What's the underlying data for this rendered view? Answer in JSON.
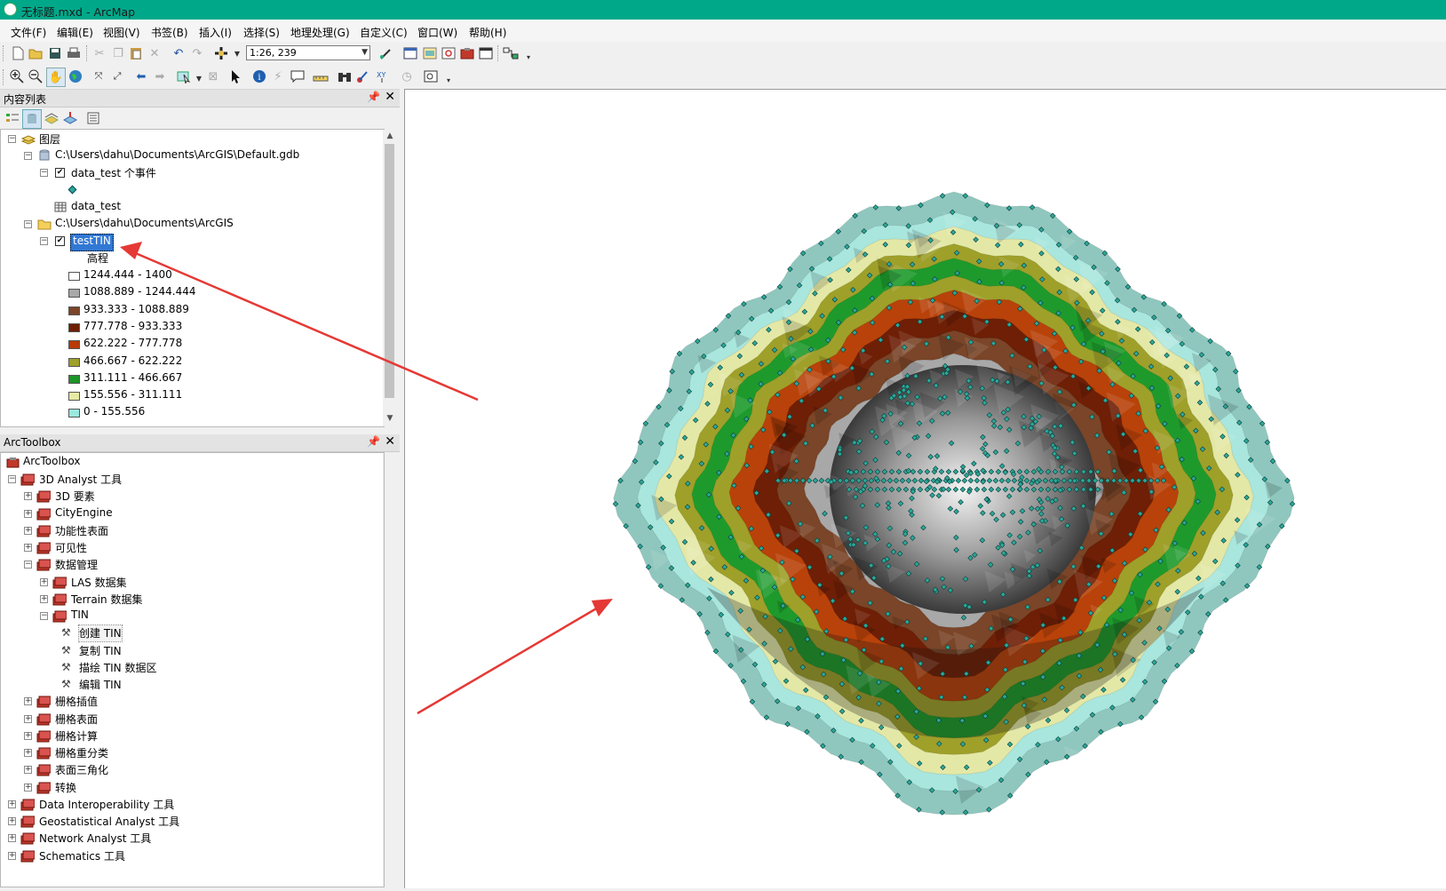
{
  "window": {
    "title": "无标题.mxd - ArcMap"
  },
  "menu": [
    "文件(F)",
    "编辑(E)",
    "视图(V)",
    "书签(B)",
    "插入(I)",
    "选择(S)",
    "地理处理(G)",
    "自定义(C)",
    "窗口(W)",
    "帮助(H)"
  ],
  "toolbar": {
    "scale": "1:26, 239"
  },
  "toc": {
    "title": "内容列表",
    "root": "图层",
    "gdb_path": "C:\\Users\\dahu\\Documents\\ArcGIS\\Default.gdb",
    "event_layer": "data_test 个事件",
    "table": "data_test",
    "folder_path": "C:\\Users\\dahu\\Documents\\ArcGIS",
    "tin_layer": "testTIN",
    "field": "高程",
    "classes": [
      {
        "label": "1244.444 - 1400",
        "color": "#ffffff"
      },
      {
        "label": "1088.889 - 1244.444",
        "color": "#a8a8a8"
      },
      {
        "label": "933.333 - 1088.889",
        "color": "#7a4528"
      },
      {
        "label": "777.778 - 933.333",
        "color": "#6e1f06"
      },
      {
        "label": "622.222 - 777.778",
        "color": "#b83a06"
      },
      {
        "label": "466.667 - 622.222",
        "color": "#9ea02a"
      },
      {
        "label": "311.111 - 466.667",
        "color": "#1d9428"
      },
      {
        "label": "155.556 - 311.111",
        "color": "#e6eaa4"
      },
      {
        "label": "0 - 155.556",
        "color": "#9be8de"
      }
    ]
  },
  "toolbox": {
    "title": "ArcToolbox",
    "root": "ArcToolbox",
    "items": [
      {
        "label": "3D Analyst 工具",
        "level": 1,
        "exp": "-",
        "type": "box"
      },
      {
        "label": "3D 要素",
        "level": 2,
        "exp": "+",
        "type": "box"
      },
      {
        "label": "CityEngine",
        "level": 2,
        "exp": "+",
        "type": "box"
      },
      {
        "label": "功能性表面",
        "level": 2,
        "exp": "+",
        "type": "box"
      },
      {
        "label": "可见性",
        "level": 2,
        "exp": "+",
        "type": "box"
      },
      {
        "label": "数据管理",
        "level": 2,
        "exp": "-",
        "type": "box"
      },
      {
        "label": "LAS 数据集",
        "level": 3,
        "exp": "+",
        "type": "box"
      },
      {
        "label": "Terrain 数据集",
        "level": 3,
        "exp": "+",
        "type": "box"
      },
      {
        "label": "TIN",
        "level": 3,
        "exp": "-",
        "type": "box"
      },
      {
        "label": "创建 TIN",
        "level": 4,
        "exp": "",
        "type": "tool"
      },
      {
        "label": "复制 TIN",
        "level": 4,
        "exp": "",
        "type": "tool"
      },
      {
        "label": "描绘 TIN 数据区",
        "level": 4,
        "exp": "",
        "type": "tool"
      },
      {
        "label": "编辑 TIN",
        "level": 4,
        "exp": "",
        "type": "tool"
      },
      {
        "label": "栅格插值",
        "level": 2,
        "exp": "+",
        "type": "box"
      },
      {
        "label": "栅格表面",
        "level": 2,
        "exp": "+",
        "type": "box"
      },
      {
        "label": "栅格计算",
        "level": 2,
        "exp": "+",
        "type": "box"
      },
      {
        "label": "栅格重分类",
        "level": 2,
        "exp": "+",
        "type": "box"
      },
      {
        "label": "表面三角化",
        "level": 2,
        "exp": "+",
        "type": "box"
      },
      {
        "label": "转换",
        "level": 2,
        "exp": "+",
        "type": "box"
      },
      {
        "label": "Data Interoperability 工具",
        "level": 1,
        "exp": "+",
        "type": "box"
      },
      {
        "label": "Geostatistical Analyst 工具",
        "level": 1,
        "exp": "+",
        "type": "box"
      },
      {
        "label": "Network Analyst 工具",
        "level": 1,
        "exp": "+",
        "type": "box"
      },
      {
        "label": "Schematics 工具",
        "level": 1,
        "exp": "+",
        "type": "box"
      }
    ]
  },
  "colors": {
    "titlebar": "#00a88a",
    "arrow": "#e53935",
    "point": "#2aa89a"
  }
}
